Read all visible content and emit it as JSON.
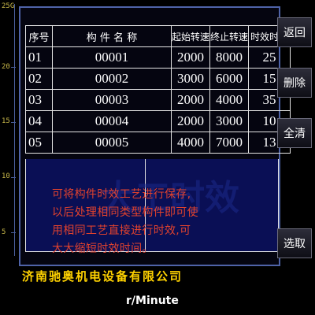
{
  "y_axis": {
    "ticks": [
      "25G",
      "20",
      "15",
      "10",
      "5"
    ]
  },
  "table": {
    "headers": [
      "序号",
      "构 件 名 称",
      "起始转速",
      "终止转速",
      "时效时间"
    ],
    "rows": [
      [
        "01",
        "00001",
        "2000",
        "8000",
        "25"
      ],
      [
        "02",
        "00002",
        "3000",
        "6000",
        "15"
      ],
      [
        "03",
        "00003",
        "2000",
        "4000",
        "35"
      ],
      [
        "04",
        "00004",
        "2000",
        "3000",
        "10"
      ],
      [
        "05",
        "00005",
        "4000",
        "7000",
        "13"
      ]
    ]
  },
  "note": {
    "line1": "可将构件时效工艺进行保存,",
    "line2": "以后处理相同类型构件即可使",
    "line3": "用相同工艺直接进行时效,可",
    "line4": "大大缩短时效时间。"
  },
  "watermark": "大工时效",
  "company": "济南驰奥机电设备有限公司",
  "x_unit": "r/Minute",
  "buttons": {
    "back": "返回",
    "delete": "删除",
    "clear_all": "全清",
    "select": "选取"
  }
}
